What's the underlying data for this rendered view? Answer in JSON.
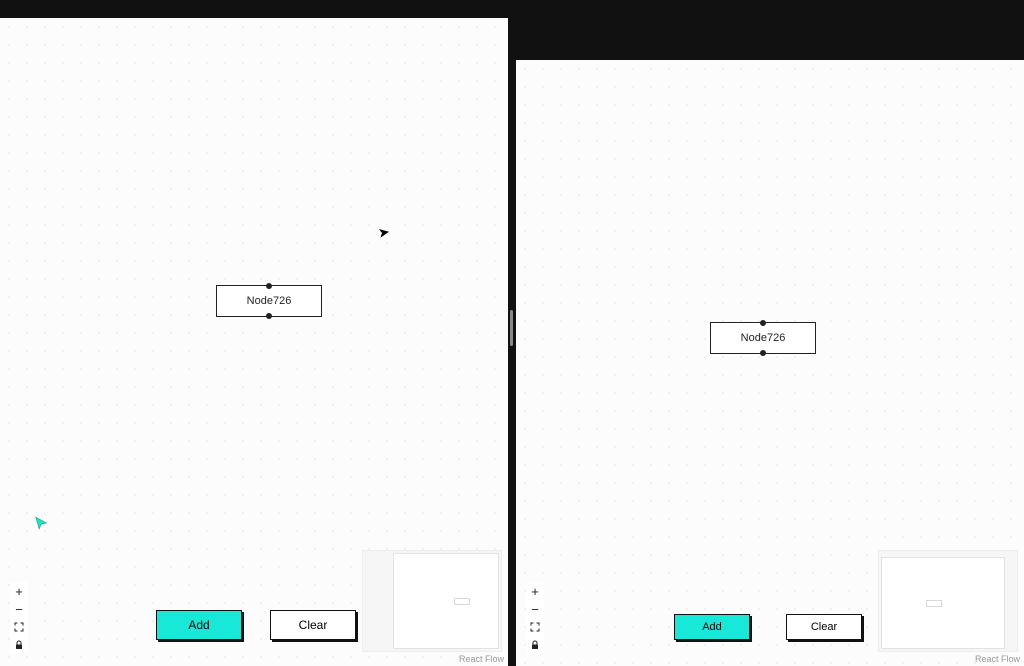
{
  "panes": {
    "left": {
      "node_label": "Node726",
      "buttons": {
        "add": "Add",
        "clear": "Clear"
      },
      "attribution": "React Flow",
      "controls": {
        "zoom_in": "+",
        "zoom_out": "−",
        "fit_view": "fit-view-icon",
        "lock": "lock-icon"
      }
    },
    "right": {
      "node_label": "Node726",
      "buttons": {
        "add": "Add",
        "clear": "Clear"
      },
      "attribution": "React Flow",
      "controls": {
        "zoom_in": "+",
        "zoom_out": "−",
        "fit_view": "fit-view-icon",
        "lock": "lock-icon"
      }
    }
  }
}
